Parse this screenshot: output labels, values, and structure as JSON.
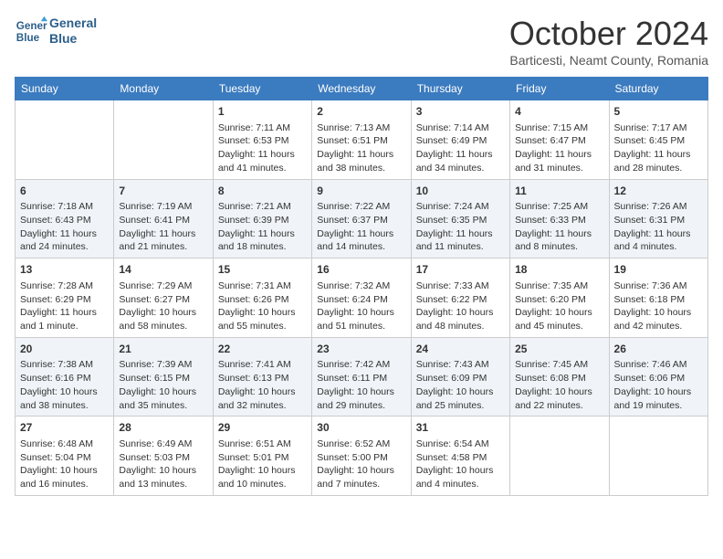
{
  "header": {
    "logo_line1": "General",
    "logo_line2": "Blue",
    "month": "October 2024",
    "location": "Barticesti, Neamt County, Romania"
  },
  "weekdays": [
    "Sunday",
    "Monday",
    "Tuesday",
    "Wednesday",
    "Thursday",
    "Friday",
    "Saturday"
  ],
  "weeks": [
    [
      {
        "day": "",
        "text": ""
      },
      {
        "day": "",
        "text": ""
      },
      {
        "day": "1",
        "text": "Sunrise: 7:11 AM\nSunset: 6:53 PM\nDaylight: 11 hours and 41 minutes."
      },
      {
        "day": "2",
        "text": "Sunrise: 7:13 AM\nSunset: 6:51 PM\nDaylight: 11 hours and 38 minutes."
      },
      {
        "day": "3",
        "text": "Sunrise: 7:14 AM\nSunset: 6:49 PM\nDaylight: 11 hours and 34 minutes."
      },
      {
        "day": "4",
        "text": "Sunrise: 7:15 AM\nSunset: 6:47 PM\nDaylight: 11 hours and 31 minutes."
      },
      {
        "day": "5",
        "text": "Sunrise: 7:17 AM\nSunset: 6:45 PM\nDaylight: 11 hours and 28 minutes."
      }
    ],
    [
      {
        "day": "6",
        "text": "Sunrise: 7:18 AM\nSunset: 6:43 PM\nDaylight: 11 hours and 24 minutes."
      },
      {
        "day": "7",
        "text": "Sunrise: 7:19 AM\nSunset: 6:41 PM\nDaylight: 11 hours and 21 minutes."
      },
      {
        "day": "8",
        "text": "Sunrise: 7:21 AM\nSunset: 6:39 PM\nDaylight: 11 hours and 18 minutes."
      },
      {
        "day": "9",
        "text": "Sunrise: 7:22 AM\nSunset: 6:37 PM\nDaylight: 11 hours and 14 minutes."
      },
      {
        "day": "10",
        "text": "Sunrise: 7:24 AM\nSunset: 6:35 PM\nDaylight: 11 hours and 11 minutes."
      },
      {
        "day": "11",
        "text": "Sunrise: 7:25 AM\nSunset: 6:33 PM\nDaylight: 11 hours and 8 minutes."
      },
      {
        "day": "12",
        "text": "Sunrise: 7:26 AM\nSunset: 6:31 PM\nDaylight: 11 hours and 4 minutes."
      }
    ],
    [
      {
        "day": "13",
        "text": "Sunrise: 7:28 AM\nSunset: 6:29 PM\nDaylight: 11 hours and 1 minute."
      },
      {
        "day": "14",
        "text": "Sunrise: 7:29 AM\nSunset: 6:27 PM\nDaylight: 10 hours and 58 minutes."
      },
      {
        "day": "15",
        "text": "Sunrise: 7:31 AM\nSunset: 6:26 PM\nDaylight: 10 hours and 55 minutes."
      },
      {
        "day": "16",
        "text": "Sunrise: 7:32 AM\nSunset: 6:24 PM\nDaylight: 10 hours and 51 minutes."
      },
      {
        "day": "17",
        "text": "Sunrise: 7:33 AM\nSunset: 6:22 PM\nDaylight: 10 hours and 48 minutes."
      },
      {
        "day": "18",
        "text": "Sunrise: 7:35 AM\nSunset: 6:20 PM\nDaylight: 10 hours and 45 minutes."
      },
      {
        "day": "19",
        "text": "Sunrise: 7:36 AM\nSunset: 6:18 PM\nDaylight: 10 hours and 42 minutes."
      }
    ],
    [
      {
        "day": "20",
        "text": "Sunrise: 7:38 AM\nSunset: 6:16 PM\nDaylight: 10 hours and 38 minutes."
      },
      {
        "day": "21",
        "text": "Sunrise: 7:39 AM\nSunset: 6:15 PM\nDaylight: 10 hours and 35 minutes."
      },
      {
        "day": "22",
        "text": "Sunrise: 7:41 AM\nSunset: 6:13 PM\nDaylight: 10 hours and 32 minutes."
      },
      {
        "day": "23",
        "text": "Sunrise: 7:42 AM\nSunset: 6:11 PM\nDaylight: 10 hours and 29 minutes."
      },
      {
        "day": "24",
        "text": "Sunrise: 7:43 AM\nSunset: 6:09 PM\nDaylight: 10 hours and 25 minutes."
      },
      {
        "day": "25",
        "text": "Sunrise: 7:45 AM\nSunset: 6:08 PM\nDaylight: 10 hours and 22 minutes."
      },
      {
        "day": "26",
        "text": "Sunrise: 7:46 AM\nSunset: 6:06 PM\nDaylight: 10 hours and 19 minutes."
      }
    ],
    [
      {
        "day": "27",
        "text": "Sunrise: 6:48 AM\nSunset: 5:04 PM\nDaylight: 10 hours and 16 minutes."
      },
      {
        "day": "28",
        "text": "Sunrise: 6:49 AM\nSunset: 5:03 PM\nDaylight: 10 hours and 13 minutes."
      },
      {
        "day": "29",
        "text": "Sunrise: 6:51 AM\nSunset: 5:01 PM\nDaylight: 10 hours and 10 minutes."
      },
      {
        "day": "30",
        "text": "Sunrise: 6:52 AM\nSunset: 5:00 PM\nDaylight: 10 hours and 7 minutes."
      },
      {
        "day": "31",
        "text": "Sunrise: 6:54 AM\nSunset: 4:58 PM\nDaylight: 10 hours and 4 minutes."
      },
      {
        "day": "",
        "text": ""
      },
      {
        "day": "",
        "text": ""
      }
    ]
  ]
}
